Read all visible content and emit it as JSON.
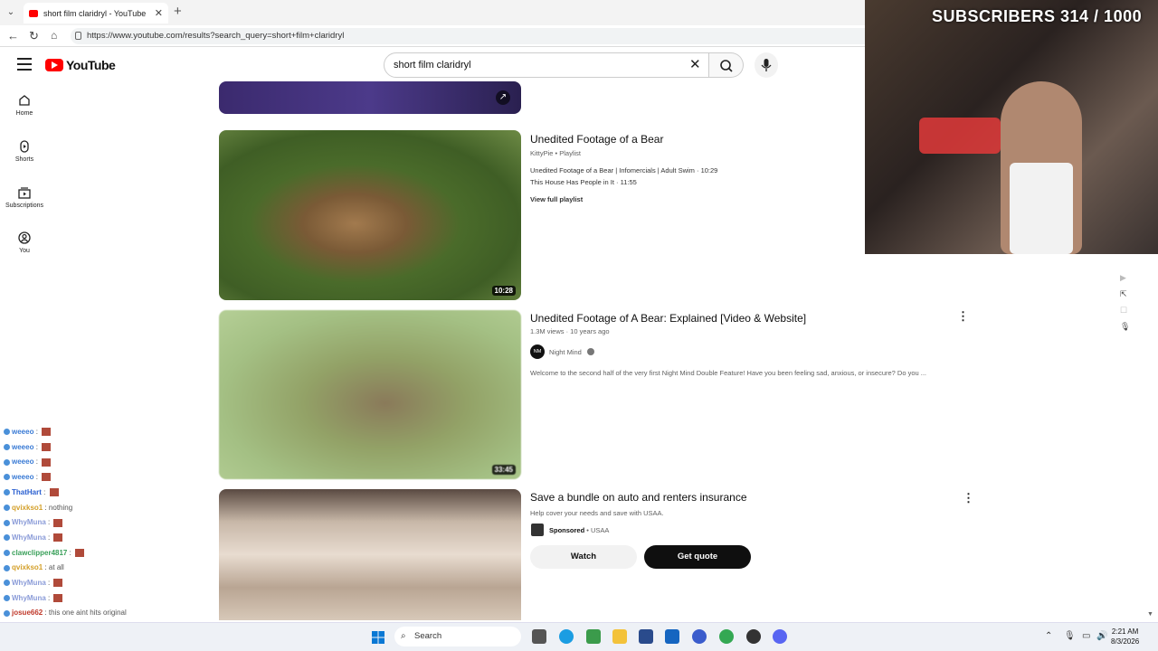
{
  "browser": {
    "tab_title": "short film claridryl - YouTube",
    "url": "https://www.youtube.com/results?search_query=short+film+claridryl"
  },
  "youtube": {
    "logo": "YouTube",
    "search_value": "short film claridryl",
    "sidebar": [
      {
        "label": "Home",
        "icon": "home-icon"
      },
      {
        "label": "Shorts",
        "icon": "shorts-icon"
      },
      {
        "label": "Subscriptions",
        "icon": "subscriptions-icon"
      },
      {
        "label": "You",
        "icon": "you-icon"
      }
    ],
    "results": [
      {
        "title": "Unedited Footage of a Bear",
        "channel": "KittyPie",
        "type": "Playlist",
        "line1": "Unedited Footage of a Bear | Infomercials | Adult Swim · 10:29",
        "line2": "This House Has People in It · 11:55",
        "view_full": "View full playlist",
        "duration": "10:28"
      },
      {
        "title": "Unedited Footage of A Bear: Explained [Video & Website]",
        "meta": "1.3M views · 10 years ago",
        "channel": "Night Mind",
        "channel_avatar": "NM",
        "description": "Welcome to the second half of the very first Night Mind Double Feature! Have you been feeling sad, anxious, or insecure? Do you ...",
        "duration": "33:45"
      },
      {
        "title": "Save a bundle on auto and renters insurance",
        "description": "Help cover your needs and save with USAA.",
        "sponsored": "Sponsored",
        "advertiser": "USAA",
        "watch_label": "Watch",
        "cta_label": "Get quote"
      }
    ]
  },
  "stream": {
    "subscribers": "SUBSCRIBERS 314 / 1000",
    "chat": [
      {
        "user": "weeeo",
        "msg": ""
      },
      {
        "user": "weeeo",
        "msg": ""
      },
      {
        "user": "weeeo",
        "msg": ""
      },
      {
        "user": "weeeo",
        "msg": ""
      },
      {
        "user": "ThatHart",
        "msg": ""
      },
      {
        "user": "qvixkso1",
        "msg": "nothing"
      },
      {
        "user": "WhyMuna",
        "msg": ""
      },
      {
        "user": "WhyMuna",
        "msg": ""
      },
      {
        "user": "clawclipper4817",
        "msg": ""
      },
      {
        "user": "qvixkso1",
        "msg": "at all"
      },
      {
        "user": "WhyMuna",
        "msg": ""
      },
      {
        "user": "WhyMuna",
        "msg": ""
      },
      {
        "user": "josue662",
        "msg": "this one aint hits original"
      }
    ]
  },
  "taskbar": {
    "search": "Search",
    "time": "2:21 AM",
    "date": "8/3/2026"
  },
  "colors": {
    "youtube_red": "#ff0000",
    "cta_bg": "#0f0f0f"
  }
}
